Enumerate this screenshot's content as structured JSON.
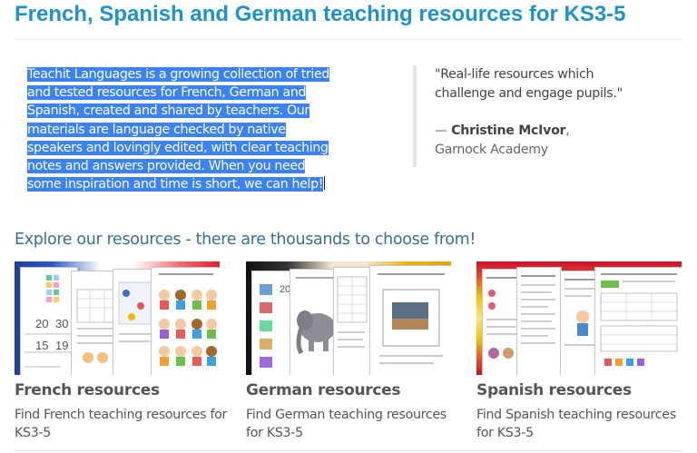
{
  "page": {
    "title": "French, Spanish and German teaching resources for KS3-5"
  },
  "intro": {
    "text": "Teachit Languages is a growing collection of tried and tested resources for French, German and Spanish, created and shared by teachers. Our materials are language checked by native speakers and lovingly edited, with clear teaching notes and answers provided. When you need some inspiration and time is short, we can help!"
  },
  "testimonial": {
    "quote": "\"Real-life resources which challenge and engage pupils.\"",
    "dash": "— ",
    "author": "Christine McIvor",
    "comma": ",",
    "school": "Garnock Academy"
  },
  "explore": {
    "heading": "Explore our resources - there are thousands to choose from!"
  },
  "cards": [
    {
      "title": "French resources",
      "desc": "Find French teaching resources for KS3-5",
      "flag_colors": [
        "#1f3f99",
        "#ffffff",
        "#e0212b"
      ]
    },
    {
      "title": "German resources",
      "desc": "Find German teaching resources for KS3-5",
      "flag_colors": [
        "#111111",
        "#d6241d",
        "#f2c200"
      ]
    },
    {
      "title": "Spanish resources",
      "desc": "Find Spanish teaching resources for KS3-5",
      "flag_colors": [
        "#c8102e",
        "#f5c400",
        "#c8102e"
      ]
    }
  ],
  "thumb_numbers": {
    "n20": "20",
    "n30": "30",
    "n15": "15",
    "n19": "19",
    "n20b": "20"
  }
}
